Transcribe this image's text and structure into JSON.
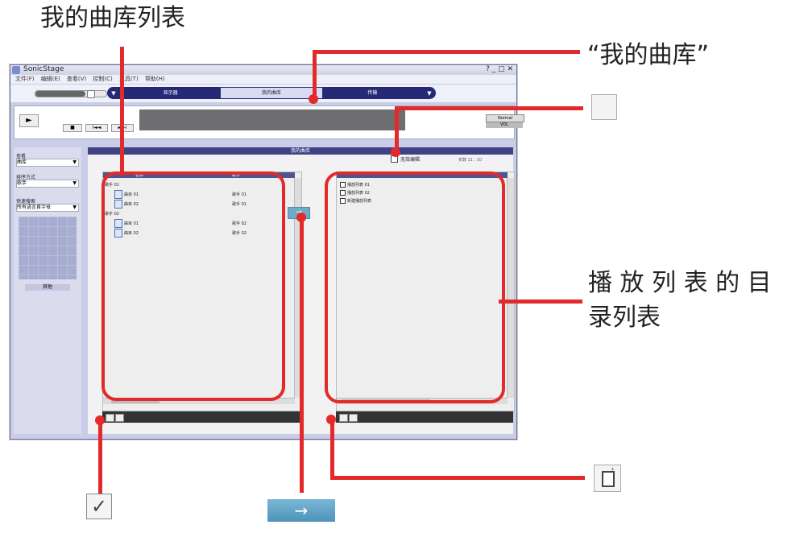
{
  "callouts": {
    "my_library_list": "我的曲库列表",
    "my_library_tab": "“我的曲库”",
    "playlist_dir_line1": "播 放 列 表 的 目",
    "playlist_dir_line2": "录列表"
  },
  "window": {
    "title": "SonicStage",
    "window_buttons": "? _ ▢ ✕",
    "menu": [
      "文件(F)",
      "编辑(E)",
      "查看(V)",
      "控制(C)",
      "工具(T)",
      "帮助(H)"
    ]
  },
  "modes": {
    "left_arrow": "▼",
    "tabs": [
      {
        "label": "显示器",
        "active": false
      },
      {
        "label": "我的曲库",
        "active": true
      },
      {
        "label": "传输",
        "active": false
      }
    ],
    "right_arrow": "▼"
  },
  "player": {
    "play_symbol": "►",
    "stop_symbol": "■",
    "prev_symbol": "I◄◄",
    "next_symbol": "►►I",
    "mode_value": "Normal",
    "volume_value": "VOL"
  },
  "sidebar": {
    "view_label": "查看",
    "view_value": "曲库",
    "sort_label": "排序方式",
    "sort_value": "歌手",
    "search_label": "快速搜索",
    "search_value": "所有语言首字母",
    "dropdown_symbol": "▼",
    "grid_button": "其他"
  },
  "content": {
    "title": "我的曲库",
    "left_panel": {
      "col_name": "名称",
      "col_artist": "歌手",
      "groups": [
        {
          "label": "歌手 01",
          "tracks": [
            {
              "name": "曲目 01",
              "artist": "歌手 01"
            },
            {
              "name": "曲目 02",
              "artist": "歌手 01"
            }
          ]
        },
        {
          "label": "歌手 02",
          "tracks": [
            {
              "name": "曲目 01",
              "artist": "歌手 02"
            },
            {
              "name": "曲目 02",
              "artist": "歌手 02"
            }
          ]
        }
      ]
    },
    "right_panel": {
      "show_checkbox_label": "无效编辑",
      "header_right": "实数 11 : 10",
      "items": [
        "播放列表 01",
        "播放列表 02",
        "新建播放列表"
      ]
    },
    "transfer_arrow": "→"
  },
  "icons": {
    "check_mark": "✓",
    "arrow": "→",
    "newdoc_star": "⁺"
  }
}
